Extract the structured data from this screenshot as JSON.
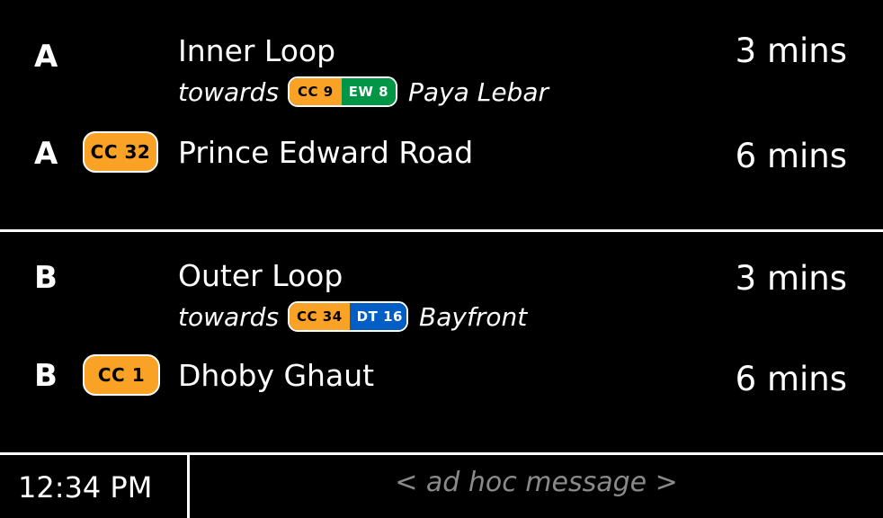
{
  "panel_a": {
    "row1": {
      "platform": "A",
      "destination": "Inner Loop",
      "towards_label": "towards",
      "codes": [
        "CC 9",
        "EW 8"
      ],
      "terminus": "Paya Lebar",
      "eta": "3 mins"
    },
    "row2": {
      "platform": "A",
      "code": "CC 32",
      "destination": "Prince Edward Road",
      "eta": "6 mins"
    }
  },
  "panel_b": {
    "row1": {
      "platform": "B",
      "destination": "Outer Loop",
      "towards_label": "towards",
      "codes": [
        "CC 34",
        "DT 16"
      ],
      "terminus": "Bayfront",
      "eta": "3 mins"
    },
    "row2": {
      "platform": "B",
      "code": "CC 1",
      "destination": "Dhoby Ghaut",
      "eta": "6 mins"
    }
  },
  "footer": {
    "clock": "12:34 PM",
    "message": "< ad hoc message >"
  },
  "colors": {
    "circle_line": "#f9a226",
    "east_west_line": "#009645",
    "downtown_line": "#005ec4",
    "background": "#000000",
    "text": "#ffffff",
    "message_text": "#8a8a8a"
  }
}
